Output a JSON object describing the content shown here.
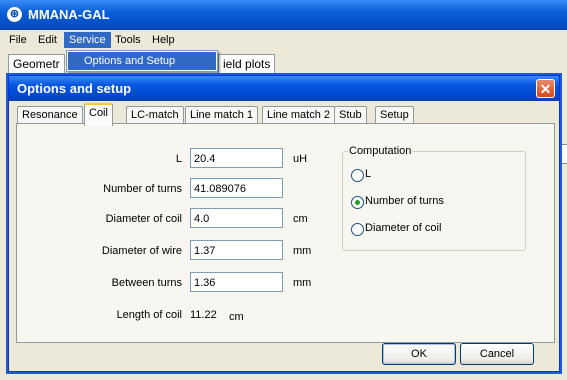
{
  "app": {
    "title": "MMANA-GAL",
    "icon": "app-logo-icon"
  },
  "menu": [
    "File",
    "Edit",
    "Service",
    "Tools",
    "Help"
  ],
  "dropdown": {
    "item": "Options and Setup"
  },
  "main_tabs": [
    "Geometr",
    "ield plots"
  ],
  "dialog": {
    "title": "Options and setup",
    "close": "✕",
    "tabs": [
      "Resonance",
      "Coil",
      "LC-match",
      "Line match  1",
      "Line match 2",
      "Stub",
      "Setup"
    ],
    "fields": {
      "L": {
        "label": "L",
        "value": "20.4",
        "unit": "uH"
      },
      "turns": {
        "label": "Number of turns",
        "value": "41.089076"
      },
      "diameter": {
        "label": "Diameter of coil",
        "value": "4.0",
        "unit": "cm"
      },
      "wire": {
        "label": "Diameter of wire",
        "value": "1.37",
        "unit": "mm"
      },
      "between": {
        "label": "Between turns",
        "value": "1.36",
        "unit": "mm"
      },
      "length": {
        "label": "Length of coil",
        "value": "11.22",
        "unit": "cm"
      }
    },
    "computation": {
      "title": "Computation",
      "options": [
        "L",
        "Number of turns",
        "Diameter of coil"
      ],
      "selected": "Number of turns"
    },
    "ok": "OK",
    "cancel": "Cancel"
  }
}
